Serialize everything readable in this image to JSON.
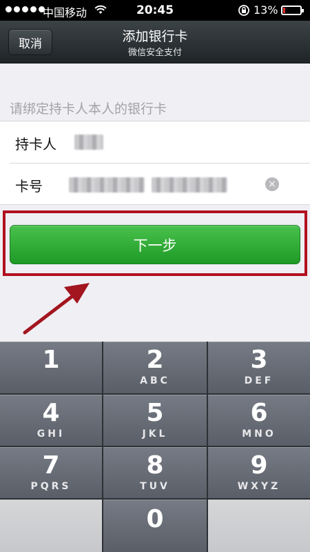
{
  "status_bar": {
    "carrier": "中国移动",
    "time": "20:45",
    "battery_percent": "13%",
    "battery_level": 0.13
  },
  "nav": {
    "cancel_label": "取消",
    "title": "添加银行卡",
    "subtitle": "微信安全支付"
  },
  "form": {
    "section_label": "请绑定持卡人本人的银行卡",
    "cardholder_label": "持卡人",
    "card_number_label": "卡号",
    "clear_icon": "×"
  },
  "next_button_label": "下一步",
  "keypad": {
    "keys": [
      {
        "num": "1",
        "letters": ""
      },
      {
        "num": "2",
        "letters": "ABC"
      },
      {
        "num": "3",
        "letters": "DEF"
      },
      {
        "num": "4",
        "letters": "GHI"
      },
      {
        "num": "5",
        "letters": "JKL"
      },
      {
        "num": "6",
        "letters": "MNO"
      },
      {
        "num": "7",
        "letters": "PQRS"
      },
      {
        "num": "8",
        "letters": "TUV"
      },
      {
        "num": "9",
        "letters": "WXYZ"
      },
      {
        "num": "0",
        "letters": ""
      }
    ]
  },
  "colors": {
    "button_green": "#2fae34",
    "highlight_red": "#b1101f",
    "arrow_red": "#a3151f"
  }
}
